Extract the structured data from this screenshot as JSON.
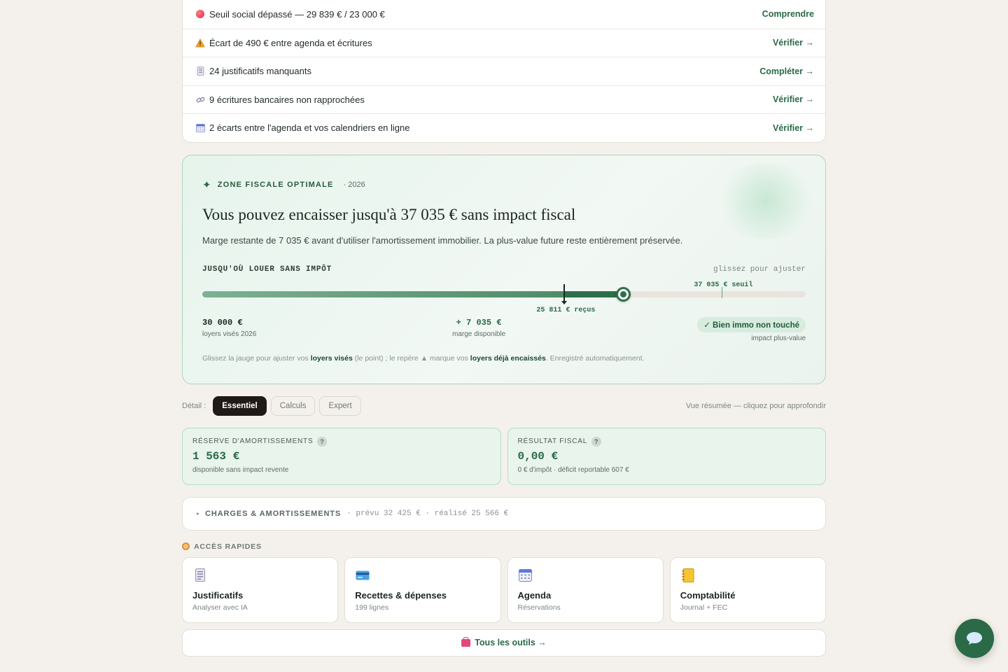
{
  "alerts": [
    {
      "icon": "red-dot-icon",
      "text": "Seuil social dépassé — 29 839 € / 23 000 €",
      "action": "Comprendre"
    },
    {
      "icon": "warning-icon",
      "text": "Écart de 490 € entre agenda et écritures",
      "action": "Vérifier →"
    },
    {
      "icon": "receipt-icon",
      "text": "24 justificatifs manquants",
      "action": "Compléter →"
    },
    {
      "icon": "link-icon",
      "text": "9 écritures bancaires non rapprochées",
      "action": "Vérifier →"
    },
    {
      "icon": "calendar-icon",
      "text": "2 écarts entre l'agenda et vos calendriers en ligne",
      "action": "Vérifier →"
    }
  ],
  "zone": {
    "header": "ZONE FISCALE OPTIMALE",
    "year": "· 2026",
    "title": "Vous pouvez encaisser jusqu'à 37 035 € sans impact fiscal",
    "subtitle": "Marge restante de 7 035 € avant d'utiliser l'amortissement immobilier. La plus-value future reste entièrement préservée.",
    "gauge_label": "JUSQU'OÙ LOUER SANS IMPÔT",
    "gauge_hint": "glissez pour ajuster",
    "gauge": {
      "max": 43000,
      "received": 25811,
      "target": 30000,
      "threshold": 37035
    },
    "threshold_label": "37 035 € seuil",
    "received_label": "25 811 € reçus",
    "target_value": "30 000 €",
    "target_caption": "loyers visés 2026",
    "margin_value": "+ 7 035 €",
    "margin_caption": "marge disponible",
    "badge": "✓ Bien immo non touché",
    "badge_caption": "impact plus-value",
    "note_1": "Glissez la jauge pour ajuster vos ",
    "note_b1": "loyers visés",
    "note_2": " (le point) ; le repère ▲ marque vos ",
    "note_b2": "loyers déjà encaissés",
    "note_3": ". Enregistré automatiquement."
  },
  "detail": {
    "label": "Détail :",
    "options": [
      "Essentiel",
      "Calculs",
      "Expert"
    ],
    "active": 0,
    "right": "Vue résumée — cliquez pour approfondir"
  },
  "kpis": [
    {
      "title": "RÉSERVE D'AMORTISSEMENTS",
      "value": "1 563 €",
      "caption": "disponible sans impact revente"
    },
    {
      "title": "RÉSULTAT FISCAL",
      "value": "0,00 €",
      "caption": "0 € d'impôt · déficit reportable 607 €"
    }
  ],
  "charges": {
    "title": "CHARGES & AMORTISSEMENTS",
    "meta": "· prévu 32 425 € · réalisé 25 566 €"
  },
  "quick": {
    "title": "ACCÈS RAPIDES",
    "cards": [
      {
        "title": "Justificatifs",
        "sub": "Analyser avec IA"
      },
      {
        "title": "Recettes & dépenses",
        "sub": "199 lignes"
      },
      {
        "title": "Agenda",
        "sub": "Réservations"
      },
      {
        "title": "Comptabilité",
        "sub": "Journal + FEC"
      }
    ],
    "tools": "Tous les outils →"
  },
  "colors": {
    "accent": "#2a6a47",
    "fill_light": "#7fb092",
    "fill_dark": "#2f6e4a"
  }
}
